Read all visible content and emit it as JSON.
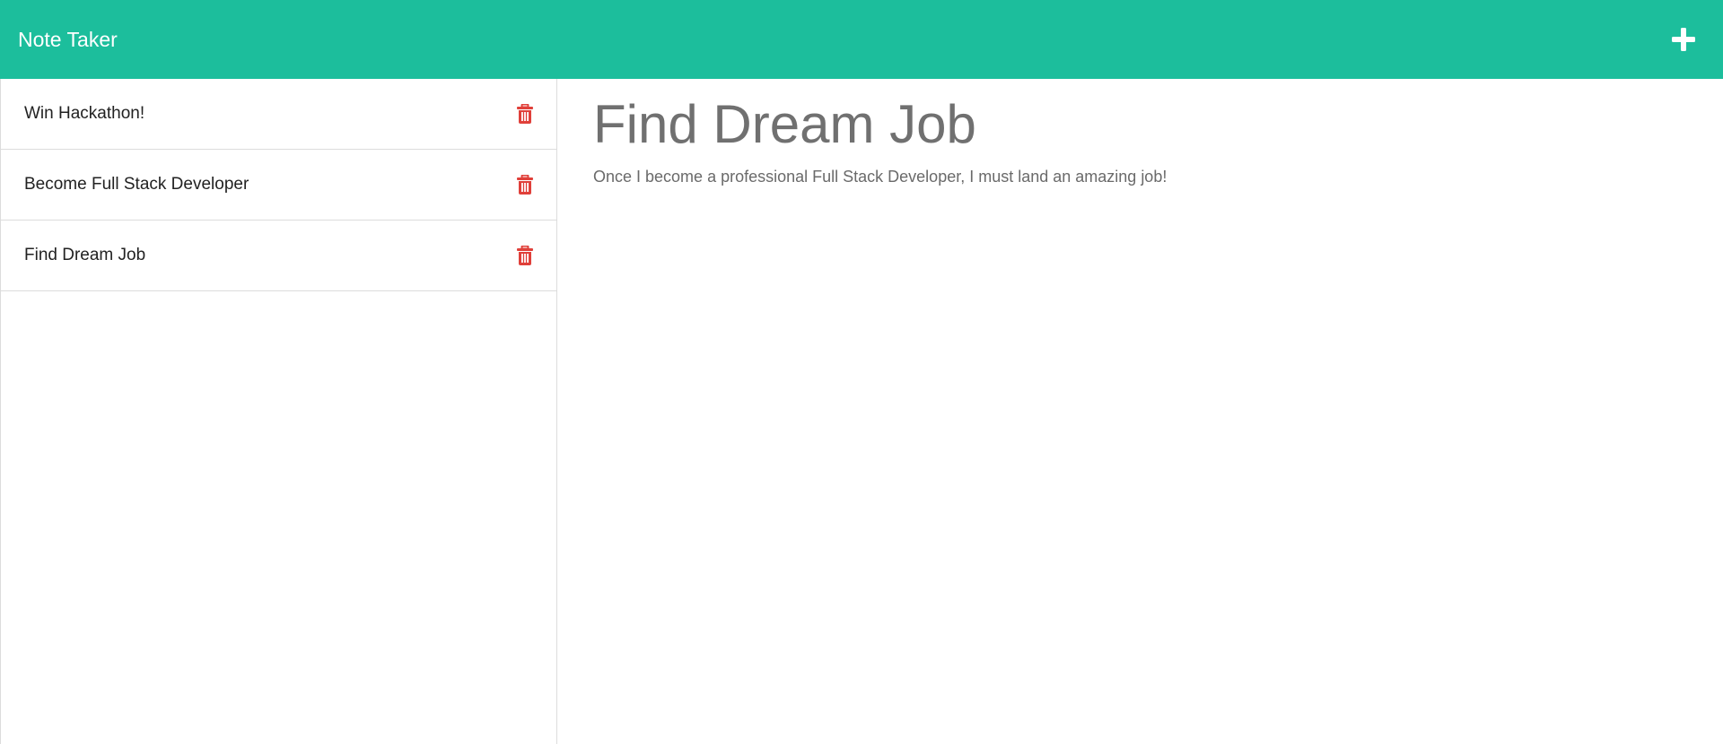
{
  "app": {
    "title": "Note Taker"
  },
  "notes": [
    {
      "title": "Win Hackathon!"
    },
    {
      "title": "Become Full Stack Developer"
    },
    {
      "title": "Find Dream Job"
    }
  ],
  "active_note": {
    "title": "Find Dream Job",
    "text": "Once I become a professional Full Stack Developer, I must land an amazing job!"
  },
  "icons": {
    "add": "plus-icon",
    "delete": "trash-icon"
  },
  "colors": {
    "navbar": "#1cbe9c",
    "delete_icon": "#e0403a",
    "heading_text": "#707070"
  }
}
